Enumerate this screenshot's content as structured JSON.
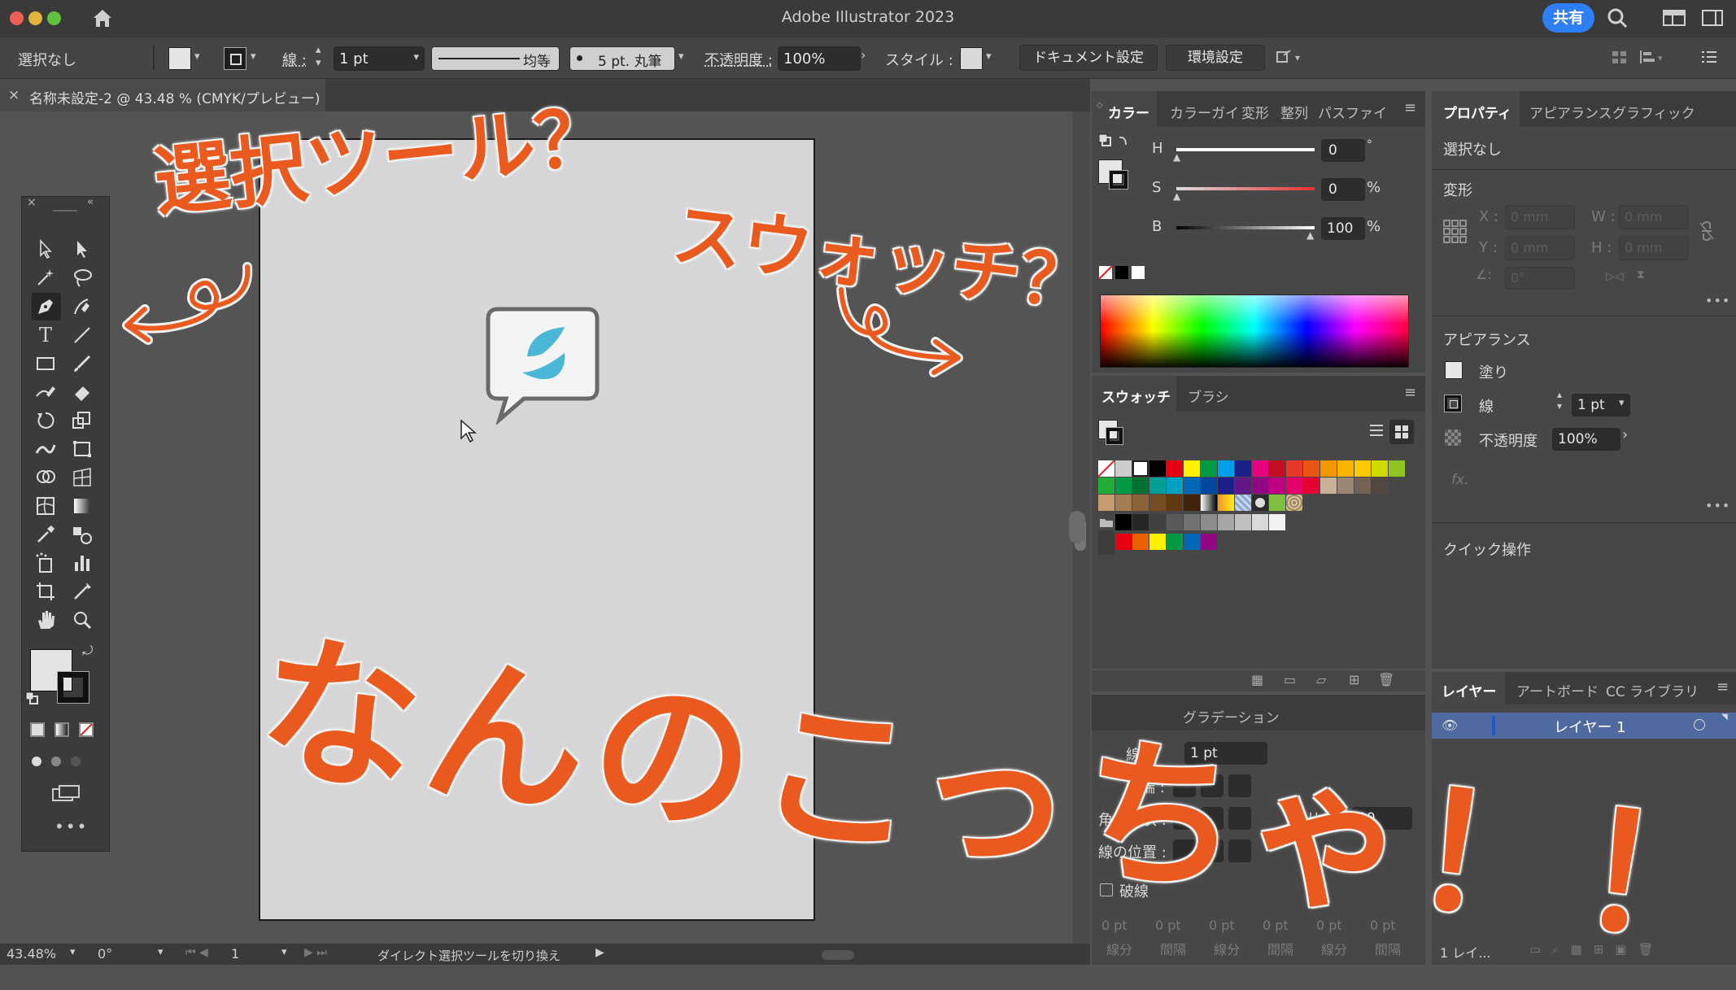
{
  "app": {
    "title": "Adobe Illustrator 2023",
    "share_label": "共有"
  },
  "control_bar": {
    "selection": "選択なし",
    "stroke_label": "線 :",
    "stroke_weight": "1 pt",
    "stroke_profile": "均等",
    "brush": "5 pt. 丸筆",
    "opacity_label": "不透明度 :",
    "opacity_value": "100%",
    "style_label": "スタイル :",
    "doc_settings": "ドキュメント設定",
    "prefs": "環境設定"
  },
  "document": {
    "tab_label": "名称未設定-2 @ 43.48 % (CMYK/プレビュー)"
  },
  "status": {
    "zoom": "43.48%",
    "rotation": "0°",
    "artboard": "1",
    "tool_hint": "ダイレクト選択ツールを切り換え"
  },
  "color_panel": {
    "tabs": [
      "カラー",
      "カラーガイ",
      "変形",
      "整列",
      "パスファイ"
    ],
    "h_label": "H",
    "h_value": "0",
    "h_unit": "°",
    "s_label": "S",
    "s_value": "0",
    "s_unit": "%",
    "b_label": "B",
    "b_value": "100",
    "b_unit": "%"
  },
  "swatches_panel": {
    "tabs": [
      "スウォッチ",
      "ブラシ"
    ]
  },
  "stroke_panel": {
    "tab": "グラデーション",
    "weight_label": "線幅",
    "weight_value": "1 pt",
    "cap_label": "線端 :",
    "corner_label": "角の形状 :",
    "limit_label": "比率 :",
    "limit_value": "10",
    "align_label": "線の位置 :",
    "dashed_label": "破線",
    "dash_fields": [
      "0 pt",
      "0 pt",
      "0 pt",
      "0 pt",
      "0 pt",
      "0 pt"
    ],
    "dash_labels": [
      "線分",
      "間隔",
      "線分",
      "間隔",
      "線分",
      "間隔"
    ]
  },
  "properties_panel": {
    "tabs": [
      "プロパティ",
      "アピアランス",
      "グラフィック"
    ],
    "selection": "選択なし",
    "transform_title": "変形",
    "x_label": "X :",
    "y_label": "Y :",
    "w_label": "W :",
    "h_label": "H :",
    "x_value": "0 mm",
    "y_value": "0 mm",
    "w_value": "0 mm",
    "h_value": "0 mm",
    "angle_value": "0°",
    "appearance_title": "アピアランス",
    "fill_label": "塗り",
    "stroke_label": "線",
    "stroke_value": "1 pt",
    "opacity_label": "不透明度",
    "opacity_value": "100%",
    "fx_label": "fx.",
    "quick_actions": "クイック操作"
  },
  "layers_panel": {
    "tabs": [
      "レイヤー",
      "アートボード",
      "CC ライブラリ"
    ],
    "layer_name": "レイヤー 1",
    "footer": "1 レイ..."
  },
  "annotations": {
    "select_tool": "選択ツール？",
    "swatch": "スウォッチ？",
    "confused": "なんのこっちゃ！！"
  },
  "colors": {
    "brand_orange": "#ea5a1f",
    "accent_blue": "#2e7ef5",
    "logo_blue": "#4bb7d6"
  }
}
